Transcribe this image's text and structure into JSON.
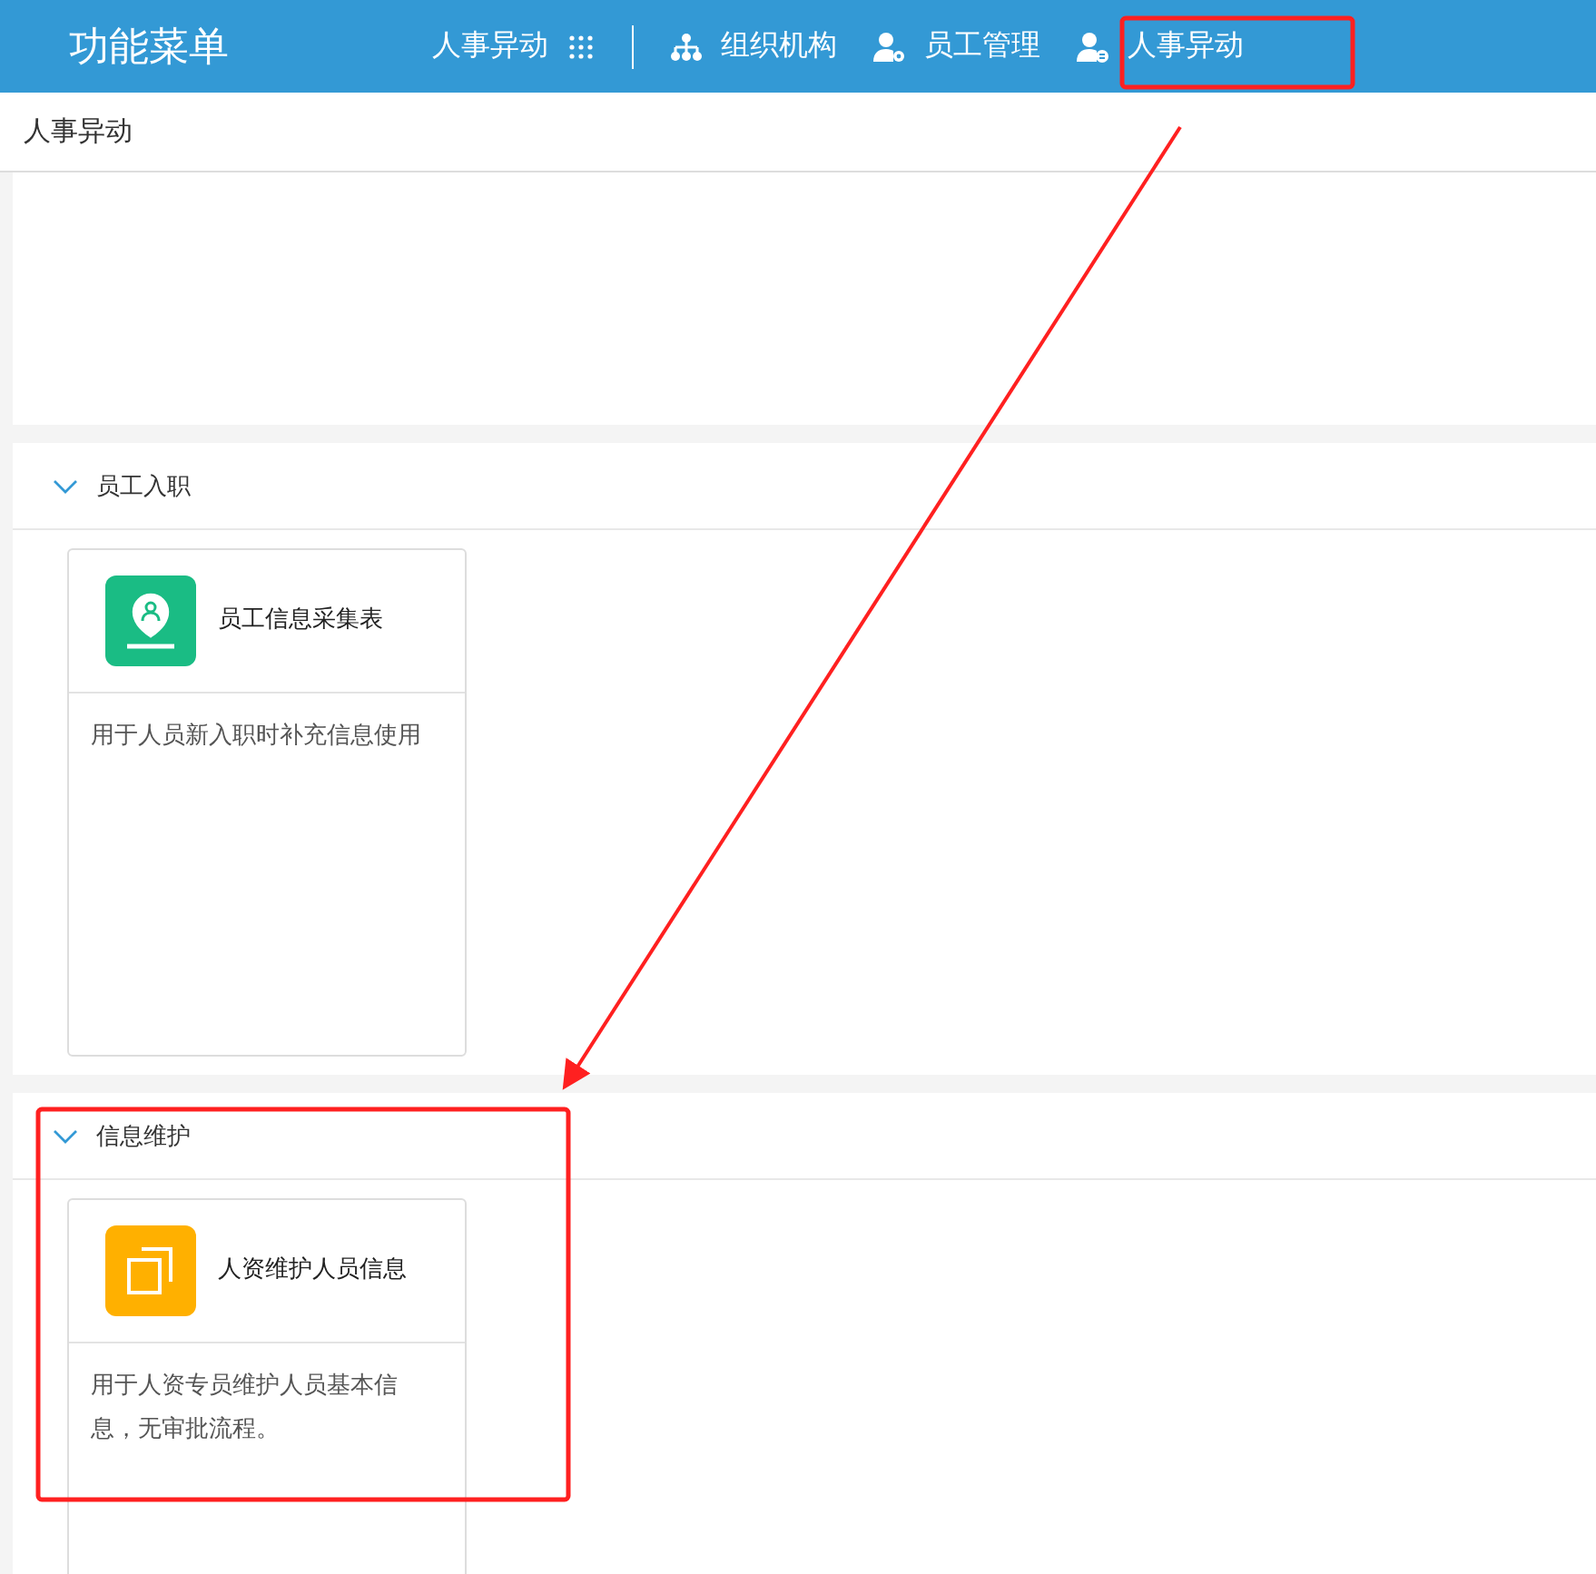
{
  "header": {
    "title": "功能菜单",
    "nav": [
      {
        "label": "人事异动",
        "kind": "dropdown"
      },
      {
        "label": "组织机构",
        "kind": "link"
      },
      {
        "label": "员工管理",
        "kind": "link"
      },
      {
        "label": "人事异动",
        "kind": "link"
      }
    ]
  },
  "breadcrumb": "人事异动",
  "sections": [
    {
      "title": "员工入职",
      "expanded": true,
      "cards": [
        {
          "title": "员工信息采集表",
          "color": "#1abc84",
          "description": "用于人员新入职时补充信息使用"
        }
      ]
    },
    {
      "title": "信息维护",
      "expanded": true,
      "cards": [
        {
          "title": "人资维护人员信息",
          "color": "#ffb000",
          "description": "用于人资专员维护人员基本信息，无审批流程。"
        }
      ]
    }
  ]
}
